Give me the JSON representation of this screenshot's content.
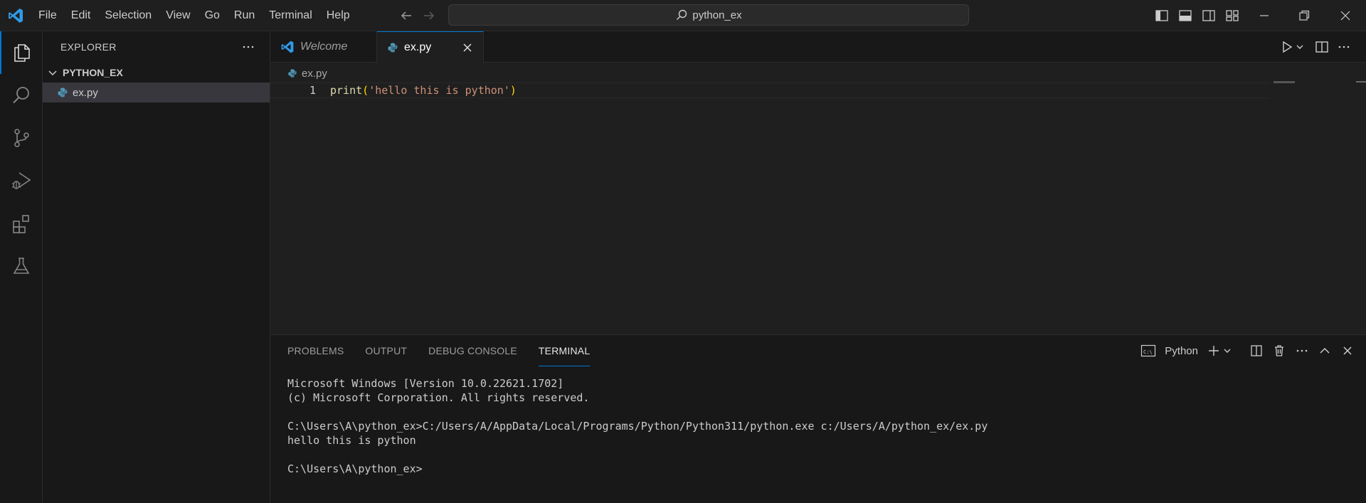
{
  "titlebar": {
    "menu": [
      "File",
      "Edit",
      "Selection",
      "View",
      "Go",
      "Run",
      "Terminal",
      "Help"
    ],
    "search_text": "python_ex"
  },
  "sidebar": {
    "title": "EXPLORER",
    "folder": "PYTHON_EX",
    "files": [
      "ex.py"
    ]
  },
  "editor": {
    "tabs": [
      {
        "label": "Welcome",
        "active": false
      },
      {
        "label": "ex.py",
        "active": true
      }
    ],
    "breadcrumb": "ex.py",
    "line_number": "1",
    "code": {
      "fn": "print",
      "open": "(",
      "str": "'hello this is python'",
      "close": ")"
    }
  },
  "panel": {
    "tabs": [
      "PROBLEMS",
      "OUTPUT",
      "DEBUG CONSOLE",
      "TERMINAL"
    ],
    "active_tab": "TERMINAL",
    "terminal_name": "Python",
    "lines": [
      "Microsoft Windows [Version 10.0.22621.1702]",
      "(c) Microsoft Corporation. All rights reserved.",
      "",
      "C:\\Users\\A\\python_ex>C:/Users/A/AppData/Local/Programs/Python/Python311/python.exe c:/Users/A/python_ex/ex.py",
      "hello this is python",
      "",
      "C:\\Users\\A\\python_ex>"
    ]
  },
  "colors": {
    "accent": "#0078d4",
    "python_icon": "#519aba",
    "string": "#ce9178",
    "function": "#dcdcaa",
    "bracket": "#ffd700"
  }
}
